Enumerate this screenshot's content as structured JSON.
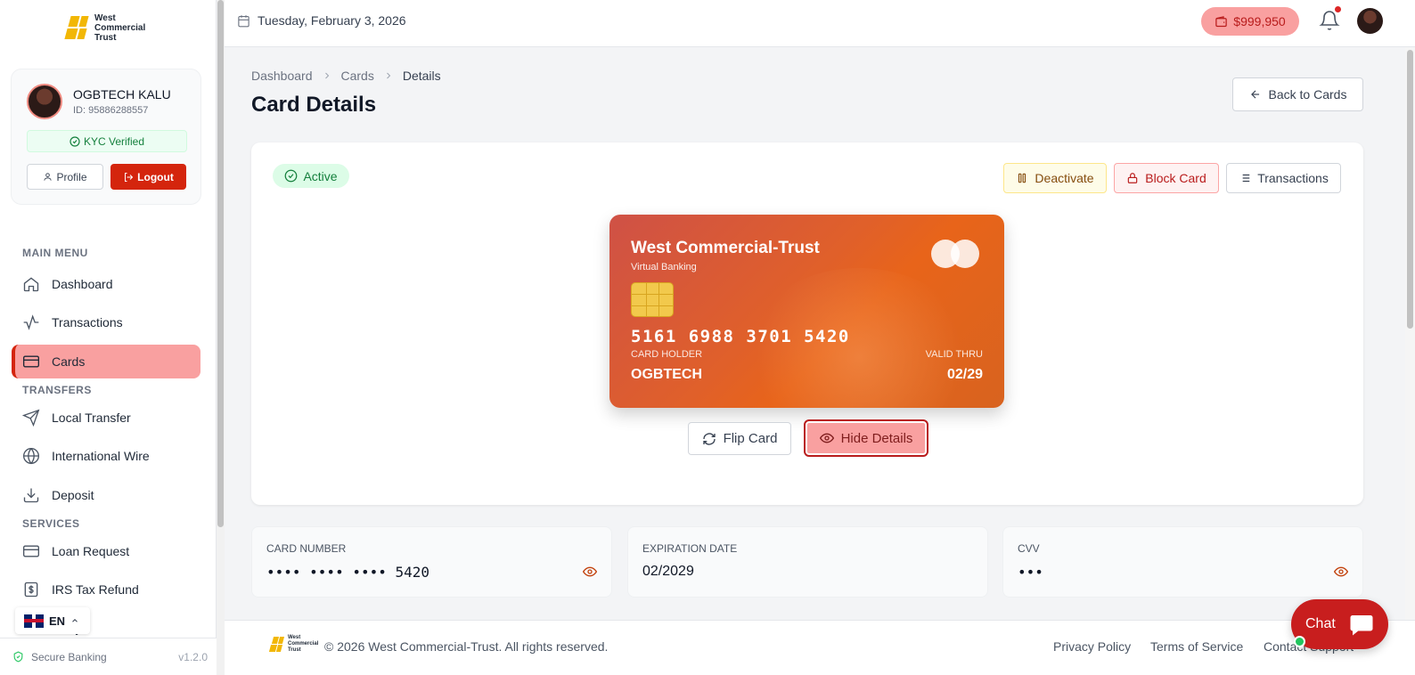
{
  "brand": {
    "name_line1": "West",
    "name_line2": "Commercial",
    "name_line3": "Trust",
    "accent": "#d4250d",
    "soft_accent": "#f9a0a0"
  },
  "user": {
    "name": "OGBTECH KALU",
    "id": "ID: 95886288557",
    "kyc": "KYC Verified",
    "profile_label": "Profile",
    "logout_label": "Logout"
  },
  "sidebar": {
    "main_menu_title": "MAIN MENU",
    "transfers_title": "TRANSFERS",
    "services_title": "SERVICES",
    "items": [
      {
        "label": "Dashboard",
        "icon": "home-icon"
      },
      {
        "label": "Transactions",
        "icon": "activity-icon"
      },
      {
        "label": "Cards",
        "icon": "credit-card-icon",
        "active": true
      },
      {
        "label": "Local Transfer",
        "icon": "send-icon"
      },
      {
        "label": "International Wire",
        "icon": "globe-icon"
      },
      {
        "label": "Deposit",
        "icon": "download-icon"
      },
      {
        "label": "Loan Request",
        "icon": "card-icon"
      },
      {
        "label": "IRS Tax Refund",
        "icon": "dollar-doc-icon"
      },
      {
        "label": "istory",
        "icon": "history-icon"
      }
    ],
    "lang": "EN",
    "secure": "Secure Banking",
    "version": "v1.2.0"
  },
  "topbar": {
    "date": "Tuesday, February 3, 2026",
    "balance": "$999,950"
  },
  "breadcrumb": [
    "Dashboard",
    "Cards",
    "Details"
  ],
  "page_title": "Card Details",
  "back_label": "Back to Cards",
  "panel": {
    "status": "Active",
    "deactivate": "Deactivate",
    "block": "Block Card",
    "transactions": "Transactions",
    "flip": "Flip Card",
    "hide": "Hide Details"
  },
  "card": {
    "bank": "West Commercial-Trust",
    "sub": "Virtual Banking",
    "number": "5161 6988 3701 5420",
    "holder_label": "CARD HOLDER",
    "holder": "OGBTECH",
    "valid_label": "VALID THRU",
    "valid": "02/29"
  },
  "info": [
    {
      "label": "CARD NUMBER",
      "value": "•••• •••• •••• 5420"
    },
    {
      "label": "EXPIRATION DATE",
      "value": "02/2029"
    },
    {
      "label": "CVV",
      "value": "•••"
    }
  ],
  "footer": {
    "copyright": "© 2026 West Commercial-Trust. All rights reserved.",
    "privacy": "Privacy Policy",
    "terms": "Terms of Service",
    "contact": "Contact Support"
  },
  "chat": "Chat"
}
